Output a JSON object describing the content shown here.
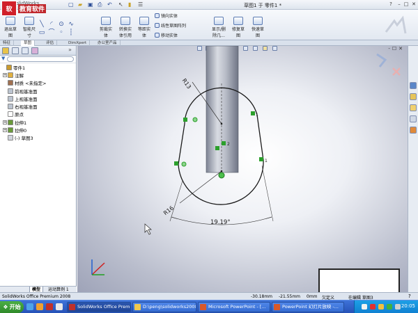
{
  "window": {
    "app_title": "SolidWorks",
    "doc_title": "草图1 于 零件1 *",
    "logo_text": "软",
    "edu_label": "教育软件"
  },
  "ribbon": {
    "exit_sketch": "退出草\n图",
    "smart_dim": "智能尺\n寸",
    "trim": "剪裁实\n体",
    "convert": "转换实\n体引用",
    "offset": "等距实\n体",
    "mirror": "镜向实体",
    "linear_pattern": "线性草图阵列",
    "move": "移动实体",
    "display_relations": "显示/删\n除几...",
    "repair": "修复草\n图",
    "quick_snaps": "快速草\n图"
  },
  "command_tabs": [
    "特征",
    "草图",
    "评估",
    "DimXpert",
    "办公室产品"
  ],
  "left_panel": {
    "tree": [
      {
        "label": "零件1",
        "indent": 0,
        "icon_color": "#c99a2e",
        "expand": ""
      },
      {
        "label": "注解",
        "indent": 1,
        "icon_color": "#e0b040",
        "expand": "+"
      },
      {
        "label": "材质 <未指定>",
        "indent": 1,
        "icon_color": "#a07050",
        "expand": ""
      },
      {
        "label": "前视基准面",
        "indent": 1,
        "icon_color": "#bcc4d0",
        "expand": ""
      },
      {
        "label": "上视基准面",
        "indent": 1,
        "icon_color": "#bcc4d0",
        "expand": ""
      },
      {
        "label": "右视基准面",
        "indent": 1,
        "icon_color": "#bcc4d0",
        "expand": ""
      },
      {
        "label": "原点",
        "indent": 1,
        "icon_color": "#ffffff",
        "expand": ""
      },
      {
        "label": "拉伸1",
        "indent": 1,
        "icon_color": "#6a9a3a",
        "expand": "+"
      },
      {
        "label": "拉伸0",
        "indent": 1,
        "icon_color": "#6a9a3a",
        "expand": "+"
      },
      {
        "label": "(-) 草图3",
        "indent": 1,
        "icon_color": "#d0d4dc",
        "expand": ""
      }
    ],
    "bottom_tabs": [
      "模型",
      "运动算例 1"
    ]
  },
  "sketch": {
    "radius_top": "R13",
    "radius_bottom": "R16",
    "angle": "19.19°",
    "relation_marks": [
      "2",
      "1",
      "1"
    ]
  },
  "status": {
    "edition": "SolidWorks Office Premium 2008",
    "x": "-30.18mm",
    "y": "-21.55mm",
    "z": "0mm",
    "state": "欠定义",
    "mode": "在编辑 草图3"
  },
  "taskbar": {
    "start": "开始",
    "tasks": [
      "SolidWorks Office Premiu...",
      "D:\\peng\\solidworks2008",
      "Microsoft PowerPoint - [...",
      "PowerPoint 幻灯片放映 -..."
    ],
    "clock": "20:05"
  },
  "colors": {
    "sketch_line": "#1a1a1a",
    "relation_green": "#2ca02c",
    "task_blue": "#356cd2",
    "tray_blue": "#0f7fd0"
  }
}
